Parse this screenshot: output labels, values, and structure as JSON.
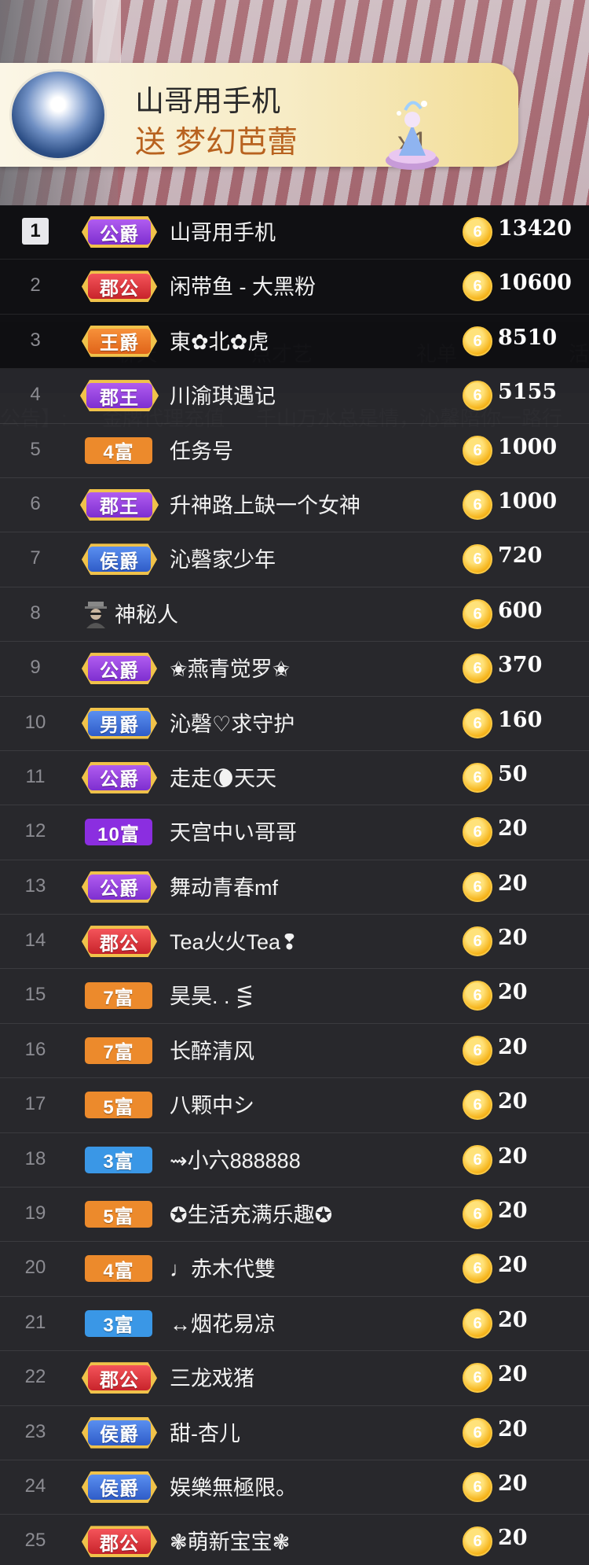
{
  "gift": {
    "sender": "山哥用手机",
    "action": "送",
    "gift_name": "梦幻芭蕾",
    "count": "x1"
  },
  "background_chat": {
    "tabs": [
      "聊天",
      "点才艺",
      "礼单",
      "活"
    ],
    "notice_prefix": "公告】:",
    "notice_tag": "金牌代理充值",
    "notice_text": "千山万水总是情，沁馨陪你一路行"
  },
  "colors": {
    "noble_gold": "#f2c14b",
    "purple": "#9b4fe0",
    "red": "#e8353b",
    "orange": "#f07a1c",
    "blue": "#3b6fd6",
    "wealth_orange": "#f08a2a",
    "wealth_purple": "#8b2ee0",
    "wealth_blue": "#3a8fe0",
    "coin": "#f6b51d"
  },
  "ranking": [
    {
      "rank": "1",
      "badge": "公爵",
      "badge_type": "noble",
      "badge_color": "purple",
      "name": "山哥用手机",
      "score": "13420"
    },
    {
      "rank": "2",
      "badge": "郡公",
      "badge_type": "noble",
      "badge_color": "red",
      "name": "闲带鱼 - 大黑粉",
      "score": "10600"
    },
    {
      "rank": "3",
      "badge": "王爵",
      "badge_type": "noble",
      "badge_color": "orange",
      "name": "東✿北✿虎",
      "score": "8510"
    },
    {
      "rank": "4",
      "badge": "郡王",
      "badge_type": "noble-wang",
      "badge_color": "purple",
      "name": "川渝琪遇记",
      "score": "5155"
    },
    {
      "rank": "5",
      "badge": "4富",
      "badge_type": "wealth",
      "badge_color": "orange",
      "name": "任务号",
      "score": "1000"
    },
    {
      "rank": "6",
      "badge": "郡王",
      "badge_type": "noble-wang",
      "badge_color": "purple",
      "name": "升神路上缺一个女神",
      "score": "1000"
    },
    {
      "rank": "7",
      "badge": "侯爵",
      "badge_type": "noble",
      "badge_color": "blue",
      "name": "沁磬家少年",
      "score": "720"
    },
    {
      "rank": "8",
      "badge": "",
      "badge_type": "mystery",
      "badge_color": "",
      "name": "神秘人",
      "score": "600"
    },
    {
      "rank": "9",
      "badge": "公爵",
      "badge_type": "noble",
      "badge_color": "purple",
      "name": "✬燕青觉罗✬",
      "score": "370"
    },
    {
      "rank": "10",
      "badge": "男爵",
      "badge_type": "noble",
      "badge_color": "blue",
      "name": "沁磬♡求守护",
      "score": "160"
    },
    {
      "rank": "11",
      "badge": "公爵",
      "badge_type": "noble",
      "badge_color": "purple",
      "name": "走走🌘天天",
      "score": "50"
    },
    {
      "rank": "12",
      "badge": "10富",
      "badge_type": "wealth",
      "badge_color": "deep-purple",
      "name": "天宫中い哥哥",
      "score": "20"
    },
    {
      "rank": "13",
      "badge": "公爵",
      "badge_type": "noble",
      "badge_color": "purple",
      "name": "舞动青春mf",
      "score": "20"
    },
    {
      "rank": "14",
      "badge": "郡公",
      "badge_type": "noble",
      "badge_color": "red",
      "name": "Tea火火Tea❢",
      "score": "20"
    },
    {
      "rank": "15",
      "badge": "7富",
      "badge_type": "wealth",
      "badge_color": "orange",
      "name": "昊昊. . ⋚",
      "score": "20"
    },
    {
      "rank": "16",
      "badge": "7富",
      "badge_type": "wealth",
      "badge_color": "orange",
      "name": "长醉清风",
      "score": "20"
    },
    {
      "rank": "17",
      "badge": "5富",
      "badge_type": "wealth",
      "badge_color": "orange",
      "name": "八颗中シ",
      "score": "20"
    },
    {
      "rank": "18",
      "badge": "3富",
      "badge_type": "wealth",
      "badge_color": "blue",
      "name": "⇝小六888888",
      "score": "20"
    },
    {
      "rank": "19",
      "badge": "5富",
      "badge_type": "wealth",
      "badge_color": "orange",
      "name": "✪生活充满乐趣✪",
      "score": "20"
    },
    {
      "rank": "20",
      "badge": "4富",
      "badge_type": "wealth",
      "badge_color": "orange",
      "name": "♩赤木代雙",
      "score": "20"
    },
    {
      "rank": "21",
      "badge": "3富",
      "badge_type": "wealth",
      "badge_color": "blue",
      "name": "↔烟花易凉",
      "score": "20"
    },
    {
      "rank": "22",
      "badge": "郡公",
      "badge_type": "noble",
      "badge_color": "red",
      "name": "三龙戏猪",
      "score": "20"
    },
    {
      "rank": "23",
      "badge": "侯爵",
      "badge_type": "noble",
      "badge_color": "blue",
      "name": "甜-杏儿",
      "score": "20"
    },
    {
      "rank": "24",
      "badge": "侯爵",
      "badge_type": "noble",
      "badge_color": "blue",
      "name": "娱樂無極限。",
      "score": "20"
    },
    {
      "rank": "25",
      "badge": "郡公",
      "badge_type": "noble",
      "badge_color": "red",
      "name": "❃萌新宝宝❃",
      "score": "20"
    }
  ],
  "coin_symbol": "6"
}
